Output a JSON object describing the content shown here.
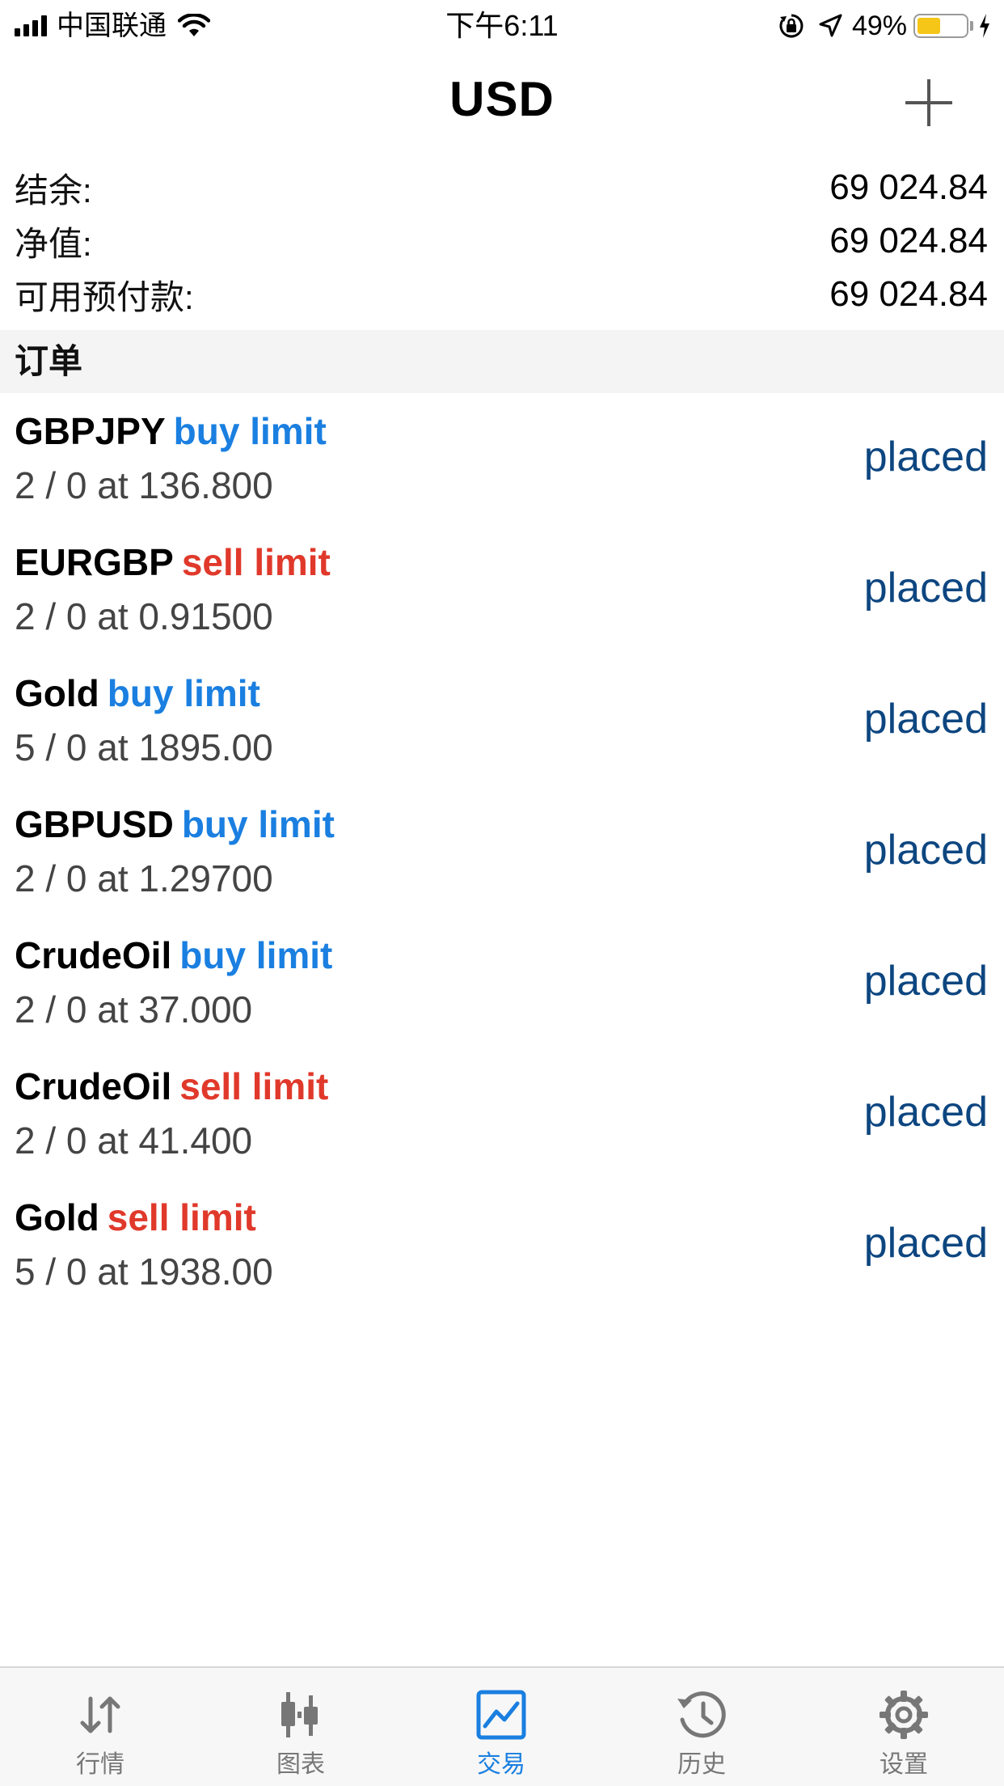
{
  "status_bar": {
    "carrier": "中国联通",
    "time": "下午6:11",
    "battery_percent": "49%",
    "battery_level": 0.49
  },
  "nav": {
    "title": "USD",
    "add_icon": "plus-icon"
  },
  "summary": [
    {
      "label": "结余:",
      "value": "69 024.84"
    },
    {
      "label": "净值:",
      "value": "69 024.84"
    },
    {
      "label": "可用预付款:",
      "value": "69 024.84"
    }
  ],
  "section_title": "订单",
  "orders": [
    {
      "symbol": "GBPJPY",
      "type": "buy limit",
      "side": "buy",
      "detail": "2 / 0 at 136.800",
      "status": "placed"
    },
    {
      "symbol": "EURGBP",
      "type": "sell limit",
      "side": "sell",
      "detail": "2 / 0 at 0.91500",
      "status": "placed"
    },
    {
      "symbol": "Gold",
      "type": "buy limit",
      "side": "buy",
      "detail": "5 / 0 at 1895.00",
      "status": "placed"
    },
    {
      "symbol": "GBPUSD",
      "type": "buy limit",
      "side": "buy",
      "detail": "2 / 0 at 1.29700",
      "status": "placed"
    },
    {
      "symbol": "CrudeOil",
      "type": "buy limit",
      "side": "buy",
      "detail": "2 / 0 at 37.000",
      "status": "placed"
    },
    {
      "symbol": "CrudeOil",
      "type": "sell limit",
      "side": "sell",
      "detail": "2 / 0 at 41.400",
      "status": "placed"
    },
    {
      "symbol": "Gold",
      "type": "sell limit",
      "side": "sell",
      "detail": "5 / 0 at 1938.00",
      "status": "placed"
    }
  ],
  "colors": {
    "buy": "#1a7fe0",
    "sell": "#e0392b",
    "status": "#0d4680",
    "tab_active": "#1a7fe0",
    "tab_inactive": "#777777"
  },
  "tabs": [
    {
      "label": "行情",
      "icon": "quotes-icon",
      "active": false
    },
    {
      "label": "图表",
      "icon": "chart-icon",
      "active": false
    },
    {
      "label": "交易",
      "icon": "trade-icon",
      "active": true
    },
    {
      "label": "历史",
      "icon": "history-icon",
      "active": false
    },
    {
      "label": "设置",
      "icon": "settings-icon",
      "active": false
    }
  ]
}
